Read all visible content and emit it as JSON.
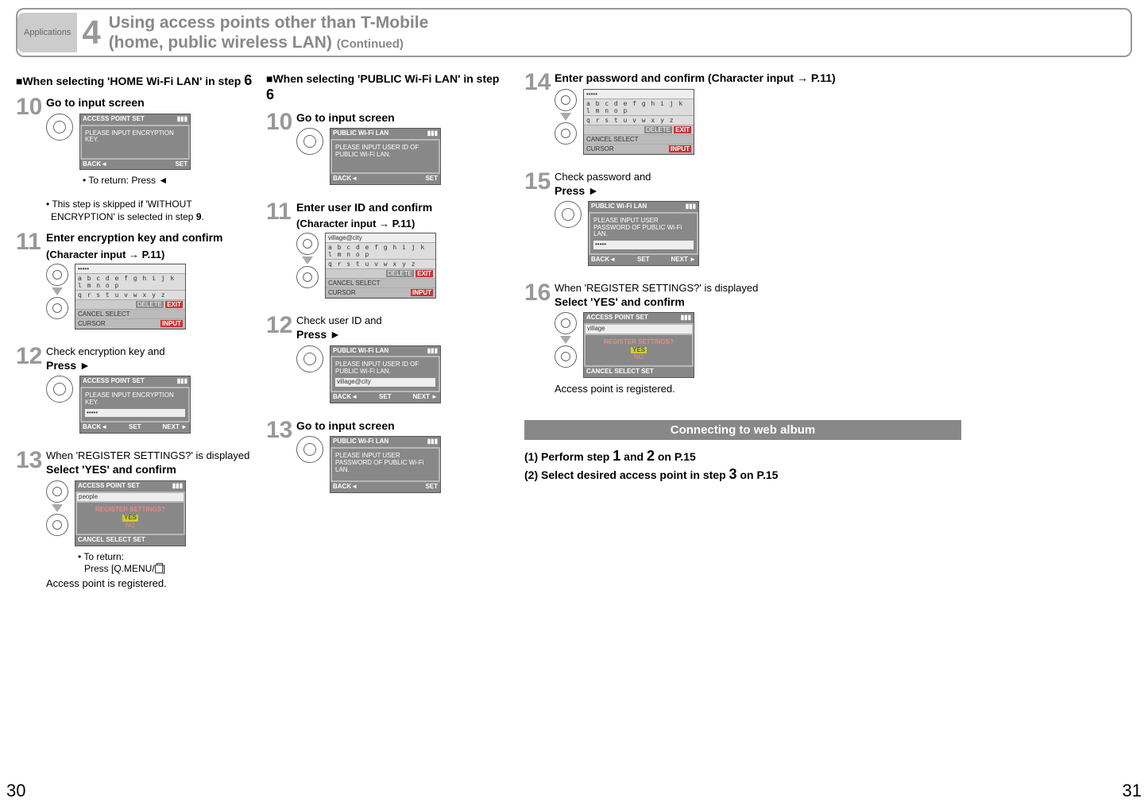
{
  "header": {
    "tab": "Applications",
    "section_number": "4",
    "title_line1": "Using access points other than T-Mobile",
    "title_line2_a": "(home, public wireless LAN) ",
    "title_line2_b": "(Continued)"
  },
  "colA": {
    "heading_prefix": "■When selecting 'HOME Wi-Fi LAN' in step ",
    "heading_num": "6",
    "s10": {
      "num": "10",
      "title": "Go to input screen",
      "lcd_top": "ACCESS POINT SET",
      "lcd_body": "PLEASE INPUT ENCRYPTION KEY.",
      "lcd_foot_l": "BACK◄",
      "lcd_foot_r": "SET",
      "note1": "• To return: Press ◄",
      "note2": "• This step is skipped if 'WITHOUT ENCRYPTION' is selected in step ",
      "note2_num": "9"
    },
    "s11": {
      "num": "11",
      "title": "Enter encryption key and confirm",
      "sub": "(Character input → P.11)",
      "char_input": "•••••",
      "char_kbd1": "a b c d e f g h i j k l m n o p",
      "char_kbd2": "q r s t u v w x y z",
      "delete": "DELETE",
      "exit": "EXIT",
      "foot1": "CANCEL",
      "foot2": "SELECT",
      "foot3": "CURSOR",
      "foot4": "INPUT"
    },
    "s12": {
      "num": "12",
      "pre": "Check encryption key and",
      "title": "Press ►",
      "lcd_top": "ACCESS POINT SET",
      "lcd_body": "PLEASE INPUT ENCRYPTION KEY.",
      "lcd_val": "•••••",
      "lcd_foot_l": "BACK◄",
      "lcd_foot_m": "SET",
      "lcd_foot_r": "NEXT ►"
    },
    "s13": {
      "num": "13",
      "pre": "When 'REGISTER SETTINGS?' is displayed",
      "title": "Select 'YES' and confirm",
      "lcd_top": "ACCESS POINT SET",
      "lcd_name": "people",
      "lcd_q": "REGISTER SETTINGS?",
      "yes": "YES",
      "no": "NO",
      "foot": "CANCEL   SELECT    SET",
      "note": "• To return:",
      "note2": "  Press [Q.MENU/     ]",
      "done": "Access point is registered."
    }
  },
  "colB": {
    "heading_prefix": "■When selecting 'PUBLIC Wi-Fi LAN' in step ",
    "heading_num": "6",
    "s10": {
      "num": "10",
      "title": "Go to input screen",
      "lcd_top": "PUBLIC Wi-Fi LAN",
      "lcd_body": "PLEASE INPUT USER ID OF PUBLIC Wi-Fi LAN.",
      "lcd_foot_l": "BACK◄",
      "lcd_foot_r": "SET"
    },
    "s11": {
      "num": "11",
      "title": "Enter user ID and confirm",
      "sub": "(Character input → P.11)",
      "char_input": "village@city",
      "char_kbd1": "a b c d e f g h i j k l m n o p",
      "char_kbd2": "q r s t u v w x y z",
      "delete": "DELETE",
      "exit": "EXIT",
      "foot1": "CANCEL",
      "foot2": "SELECT",
      "foot3": "CURSOR",
      "foot4": "INPUT"
    },
    "s12": {
      "num": "12",
      "pre": "Check user ID and",
      "title": "Press ►",
      "lcd_top": "PUBLIC Wi-Fi LAN",
      "lcd_body": "PLEASE INPUT USER ID OF PUBLIC Wi-Fi LAN.",
      "lcd_val": "village@city",
      "lcd_foot_l": "BACK◄",
      "lcd_foot_m": "SET",
      "lcd_foot_r": "NEXT ►"
    },
    "s13": {
      "num": "13",
      "title": "Go to input screen",
      "lcd_top": "PUBLIC Wi-Fi LAN",
      "lcd_body": "PLEASE INPUT USER PASSWORD OF PUBLIC Wi-Fi LAN.",
      "lcd_foot_l": "BACK◄",
      "lcd_foot_r": "SET"
    }
  },
  "colC": {
    "s14": {
      "num": "14",
      "title": "Enter password and confirm (Character input → P.11)",
      "char_input": "•••••",
      "char_kbd1": "a b c d e f g h i j k l m n o p",
      "char_kbd2": "q r s t u v w x y z",
      "delete": "DELETE",
      "exit": "EXIT",
      "foot1": "CANCEL",
      "foot2": "SELECT",
      "foot3": "CURSOR",
      "foot4": "INPUT"
    },
    "s15": {
      "num": "15",
      "pre": "Check password and",
      "title": "Press ►",
      "lcd_top": "PUBLIC Wi-Fi LAN",
      "lcd_body": "PLEASE INPUT USER PASSWORD OF PUBLIC Wi-Fi LAN.",
      "lcd_val": "•••••",
      "lcd_foot_l": "BACK◄",
      "lcd_foot_m": "SET",
      "lcd_foot_r": "NEXT ►"
    },
    "s16": {
      "num": "16",
      "pre": "When 'REGISTER SETTINGS?' is displayed",
      "title": "Select 'YES' and confirm",
      "lcd_top": "ACCESS POINT SET",
      "lcd_name": "village",
      "lcd_q": "REGISTER SETTINGS?",
      "yes": "YES",
      "no": "NO",
      "foot": "CANCEL   SELECT    SET",
      "done": "Access point is registered."
    },
    "connect": {
      "bar": "Connecting to web album",
      "l1a": "(1) Perform step ",
      "l1b": "1",
      "l1c": " and ",
      "l1d": "2",
      "l1e": " on P.15",
      "l2a": "(2) Select desired access point in step ",
      "l2b": "3",
      "l2c": " on P.15"
    }
  },
  "pages": {
    "left": "30",
    "right": "31"
  }
}
